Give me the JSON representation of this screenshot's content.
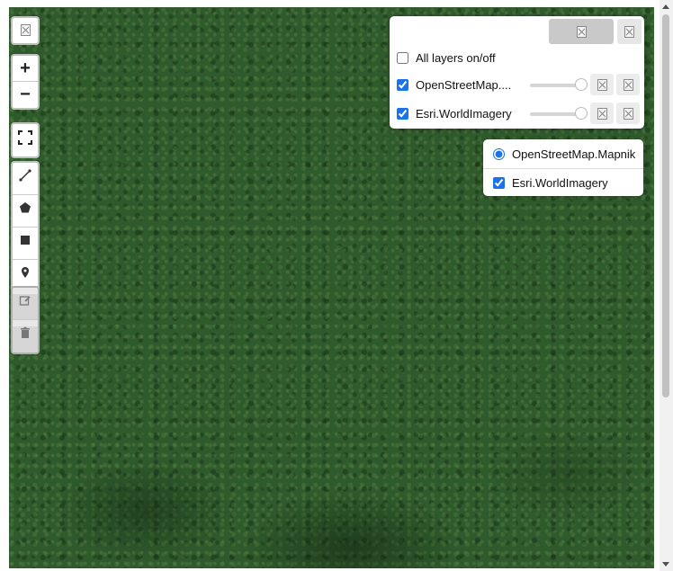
{
  "map": {
    "imagery": "satellite forest canopy",
    "colors": {
      "canopy": "#2f5a2c",
      "accent": "#1a73e8"
    }
  },
  "controls": {
    "layers_toggle_icon": "broken-image-icon",
    "zoom_in_label": "+",
    "zoom_out_label": "−",
    "fullscreen_icon": "fullscreen-icon",
    "draw_tools": [
      "polyline-icon",
      "polygon-icon",
      "rectangle-icon",
      "marker-icon"
    ],
    "edit_tools": [
      "edit-icon",
      "trash-icon"
    ]
  },
  "layer_panel": {
    "all_layers_label": "All layers on/off",
    "all_layers_checked": false,
    "layers": [
      {
        "label": "OpenStreetMap....",
        "checked": true,
        "opacity": 1.0
      },
      {
        "label": "Esri.WorldImagery",
        "checked": true,
        "opacity": 1.0
      }
    ]
  },
  "basemap_panel": {
    "radio_label": "OpenStreetMap.Mapnik",
    "radio_checked": true,
    "overlay_label": "Esri.WorldImagery",
    "overlay_checked": true
  }
}
